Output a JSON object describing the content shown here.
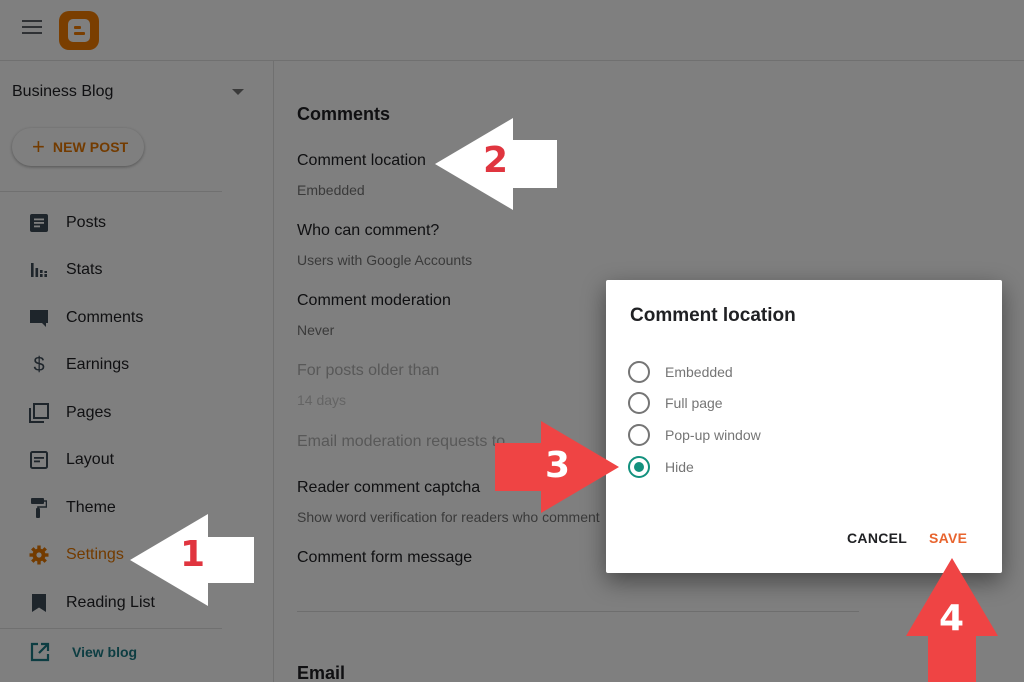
{
  "app": {
    "blog_name": "Business Blog",
    "new_post_label": "NEW POST",
    "new_post_icon": "plus-icon",
    "colors": {
      "accent": "#e67700",
      "teal": "#13917e",
      "save": "#e8642e",
      "annotation_red": "#ef4444"
    }
  },
  "sidebar": {
    "items": [
      {
        "label": "Posts",
        "icon": "posts-icon"
      },
      {
        "label": "Stats",
        "icon": "stats-icon"
      },
      {
        "label": "Comments",
        "icon": "comments-icon"
      },
      {
        "label": "Earnings",
        "icon": "dollar-icon"
      },
      {
        "label": "Pages",
        "icon": "pages-icon"
      },
      {
        "label": "Layout",
        "icon": "layout-icon"
      },
      {
        "label": "Theme",
        "icon": "paint-roller-icon"
      },
      {
        "label": "Settings",
        "icon": "gear-icon",
        "active": true
      },
      {
        "label": "Reading List",
        "icon": "bookmark-icon"
      }
    ],
    "view_blog": "View blog"
  },
  "main": {
    "section_comments": "Comments",
    "settings": [
      {
        "title": "Comment location",
        "value": "Embedded"
      },
      {
        "title": "Who can comment?",
        "value": "Users with Google Accounts"
      },
      {
        "title": "Comment moderation",
        "value": "Never"
      },
      {
        "title": "For posts older than",
        "value": "14 days",
        "disabled": true
      },
      {
        "title": "Email moderation requests to",
        "value": "",
        "disabled": true
      },
      {
        "title": "Reader comment captcha",
        "value": "Show word verification for readers who comment"
      },
      {
        "title": "Comment form message",
        "value": ""
      }
    ],
    "section_email": "Email"
  },
  "dialog": {
    "title": "Comment location",
    "options": [
      {
        "label": "Embedded",
        "checked": false
      },
      {
        "label": "Full page",
        "checked": false
      },
      {
        "label": "Pop-up window",
        "checked": false
      },
      {
        "label": "Hide",
        "checked": true
      }
    ],
    "cancel": "CANCEL",
    "save": "SAVE"
  },
  "annotations": [
    {
      "number": "1",
      "direction": "left",
      "target": "Settings"
    },
    {
      "number": "2",
      "direction": "left",
      "target": "Comment location"
    },
    {
      "number": "3",
      "direction": "right",
      "target": "Hide"
    },
    {
      "number": "4",
      "direction": "up",
      "target": "SAVE"
    }
  ]
}
